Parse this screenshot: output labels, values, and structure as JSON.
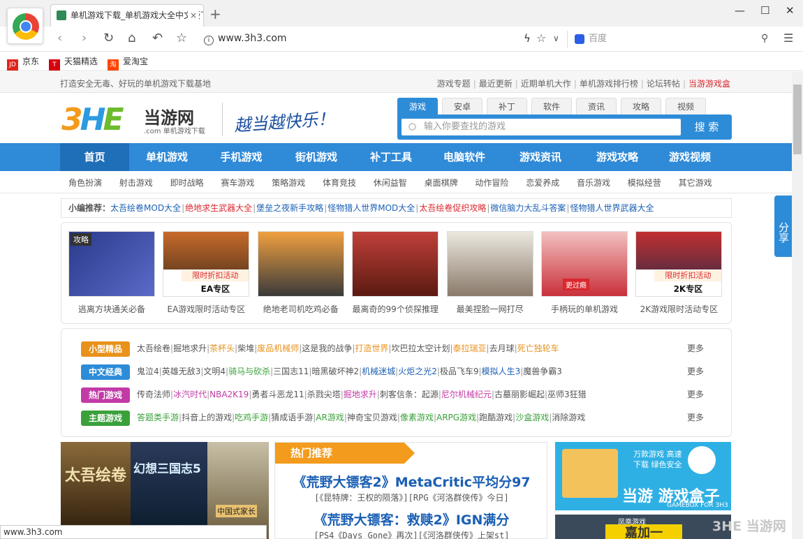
{
  "browser": {
    "tab_title": "单机游戏下载_单机游戏大全中文版下载",
    "tab_close": "×",
    "new_tab": "+",
    "url": "www.3h3.com",
    "search_placeholder": "百度",
    "bookmarks": [
      {
        "label": "京东",
        "icon": "JD",
        "color": "#e1251b"
      },
      {
        "label": "天猫精选",
        "icon": "T",
        "color": "#d7000f"
      },
      {
        "label": "爱淘宝",
        "icon": "淘",
        "color": "#ff4400"
      }
    ],
    "status_url": "www.3h3.com"
  },
  "site": {
    "slogan": "打造安全无毒、好玩的单机游戏下载基地",
    "top_links": [
      "游戏专题",
      "最近更新",
      "近期单机大作",
      "单机游戏排行榜",
      "论坛转帖",
      "当游游戏盒"
    ],
    "logo_3": "3",
    "logo_h": "H",
    "logo_e": "E",
    "brand": "当游网",
    "brand_sub": ".com 单机游戏下载",
    "tagline": "越当越快乐！",
    "search_tabs": [
      "游戏",
      "安卓",
      "补丁",
      "软件",
      "资讯",
      "攻略",
      "视频"
    ],
    "search_placeholder": "输入你要查找的游戏",
    "search_button": "搜 索",
    "main_nav": [
      "首页",
      "单机游戏",
      "手机游戏",
      "街机游戏",
      "补丁工具",
      "电脑软件",
      "游戏资讯",
      "游戏攻略",
      "游戏视频"
    ],
    "sub_nav": [
      "角色扮演",
      "射击游戏",
      "即时战略",
      "赛车游戏",
      "策略游戏",
      "体育竞技",
      "休闲益智",
      "桌面棋牌",
      "动作冒险",
      "恋爱养成",
      "音乐游戏",
      "模拟经营",
      "其它游戏"
    ],
    "editor_label": "小编推荐：",
    "editor_links": [
      {
        "text": "太吾绘卷MOD大全",
        "color": "blue"
      },
      {
        "text": "绝地求生武器大全",
        "color": "red"
      },
      {
        "text": "堡垒之夜新手攻略",
        "color": "blue"
      },
      {
        "text": "怪物猎人世界MOD大全",
        "color": "blue"
      },
      {
        "text": "太吾绘卷促织攻略",
        "color": "red"
      },
      {
        "text": "微信脑力大乱斗答案",
        "color": "blue"
      },
      {
        "text": "怪物猎人世界武器大全",
        "color": "blue"
      }
    ],
    "gallery": [
      {
        "caption": "逃离方块通关必备",
        "tag": "攻略"
      },
      {
        "caption": "EA游戏限时活动专区",
        "promo": "限时折扣活动",
        "promo2": "EA专区"
      },
      {
        "caption": "绝地老司机吃鸡必备"
      },
      {
        "caption": "最离奇的99个侦探推理"
      },
      {
        "caption": "最美捏脸一网打尽"
      },
      {
        "caption": "手柄玩的单机游戏",
        "promo_badge": "更过瘾"
      },
      {
        "caption": "2K游戏限时活动专区",
        "promo": "限时折扣活动",
        "promo2": "2K专区"
      }
    ],
    "categories": [
      {
        "label": "小型精品",
        "color": "#e8921b",
        "items": [
          [
            "太吾绘卷",
            ""
          ],
          [
            "掘地求升",
            ""
          ],
          [
            "茶杯头",
            "o"
          ],
          [
            "柴堆",
            ""
          ],
          [
            "废品机械师",
            "o"
          ],
          [
            "这是我的战争",
            ""
          ],
          [
            "打造世界",
            "o"
          ],
          [
            "坎巴拉太空计划",
            ""
          ],
          [
            "泰拉瑞亚",
            "o"
          ],
          [
            "去月球",
            ""
          ],
          [
            "死亡独轮车",
            "o"
          ]
        ]
      },
      {
        "label": "中文经典",
        "color": "#2d8cd8",
        "items": [
          [
            "鬼泣4",
            ""
          ],
          [
            "英雄无敌3",
            ""
          ],
          [
            "文明4",
            ""
          ],
          [
            "骑马与砍杀",
            "g"
          ],
          [
            "三国志11",
            ""
          ],
          [
            "暗黑破坏神2",
            ""
          ],
          [
            "机械迷城",
            "bl"
          ],
          [
            "火炬之光2",
            "bl"
          ],
          [
            "极品飞车9",
            ""
          ],
          [
            "模拟人生3",
            "bl"
          ],
          [
            "魔兽争霸3",
            ""
          ]
        ]
      },
      {
        "label": "热门游戏",
        "color": "#c23aa6",
        "items": [
          [
            "传奇法师",
            ""
          ],
          [
            "冰汽时代",
            "p"
          ],
          [
            "NBA2K19",
            "p"
          ],
          [
            "勇者斗恶龙11",
            ""
          ],
          [
            "杀戮尖塔",
            ""
          ],
          [
            "掘地求升",
            "p"
          ],
          [
            "刺客信条：起源",
            ""
          ],
          [
            "尼尔机械纪元",
            "p"
          ],
          [
            "古墓丽影崛起",
            ""
          ],
          [
            "巫师3狂猎",
            ""
          ]
        ]
      },
      {
        "label": "主题游戏",
        "color": "#3aa13a",
        "items": [
          [
            "答题类手游",
            "g"
          ],
          [
            "抖音上的游戏",
            ""
          ],
          [
            "吃鸡手游",
            "g"
          ],
          [
            "猜成语手游",
            ""
          ],
          [
            "AR游戏",
            "g"
          ],
          [
            "神奇宝贝游戏",
            ""
          ],
          [
            "像素游戏",
            "g"
          ],
          [
            "ARPG游戏",
            "g"
          ],
          [
            "跑酷游戏",
            ""
          ],
          [
            "沙盒游戏",
            "g"
          ],
          [
            "消除游戏",
            ""
          ]
        ]
      }
    ],
    "more": "更多",
    "hot_title": "热门推荐",
    "hot_items": [
      {
        "title": "《荒野大镖客2》MetaCritic平均分97",
        "sub": "[《昆特牌：王权的陨落》][RPG《河洛群侠传》今日]"
      },
      {
        "title": "《荒野大镖客：救赎2》IGN满分",
        "sub": "[PS4《Days Gone》再次][《河洛群侠传》上架st]"
      }
    ],
    "ad_text": "万款游戏 高速下载 绿色安全",
    "ad_brand": "当游 游戏盒子",
    "ad_sub": "GAMEBOX FOR 3H3",
    "ad2_label": "凤凰游戏",
    "ad2_big": "嘉加一",
    "share": "分享",
    "watermark": "3HE 当游网",
    "banner_titles": [
      "太吾绘卷",
      "幻想三国志5",
      "中国式家长"
    ]
  }
}
